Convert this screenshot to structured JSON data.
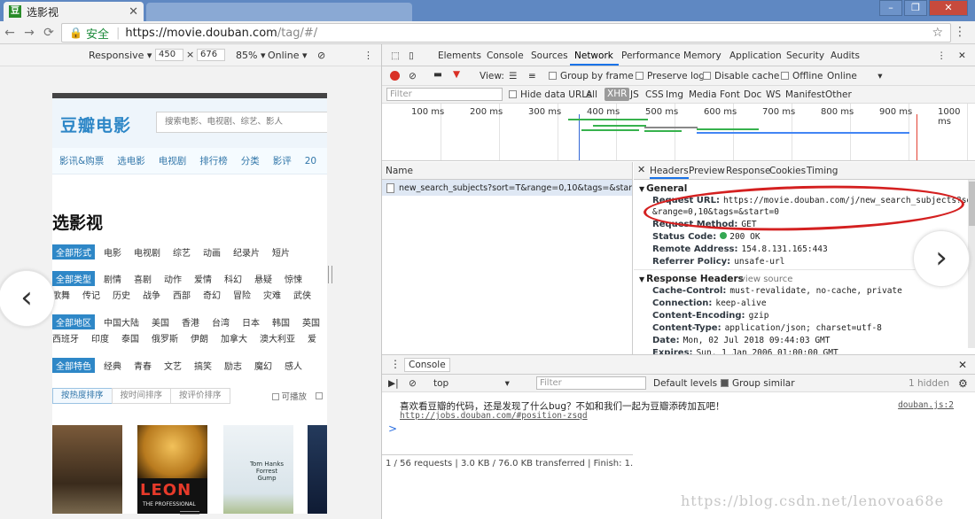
{
  "browser": {
    "active_tab_title": "选影视",
    "favicon_glyph": "豆",
    "tab_close": "✕",
    "secure_label": "安全",
    "url_host": "https://movie.douban.com",
    "url_path": "/tag/#/"
  },
  "device_toolbar": {
    "device": "Responsive",
    "width": "450",
    "times": "×",
    "height": "676",
    "zoom": "85%",
    "network": "Online"
  },
  "douban": {
    "logo": "豆瓣电影",
    "search_placeholder": "搜索电影、电视剧、综艺、影人",
    "nav": [
      "影讯&购票",
      "选电影",
      "电视剧",
      "排行榜",
      "分类",
      "影评",
      "20"
    ],
    "page_title": "选影视",
    "filters": [
      {
        "badge": "全部形式",
        "items": [
          "电影",
          "电视剧",
          "综艺",
          "动画",
          "纪录片",
          "短片"
        ]
      },
      {
        "badge": "全部类型",
        "items": [
          "剧情",
          "喜剧",
          "动作",
          "爱情",
          "科幻",
          "悬疑",
          "惊悚"
        ]
      },
      {
        "badge": "",
        "items": [
          "歌舞",
          "传记",
          "历史",
          "战争",
          "西部",
          "奇幻",
          "冒险",
          "灾难",
          "武侠"
        ]
      },
      {
        "badge": "全部地区",
        "items": [
          "中国大陆",
          "美国",
          "香港",
          "台湾",
          "日本",
          "韩国",
          "英国"
        ]
      },
      {
        "badge": "",
        "items": [
          "西班牙",
          "印度",
          "泰国",
          "俄罗斯",
          "伊朗",
          "加拿大",
          "澳大利亚",
          "爱"
        ]
      },
      {
        "badge": "全部特色",
        "items": [
          "经典",
          "青春",
          "文艺",
          "搞笑",
          "励志",
          "魔幻",
          "感人"
        ]
      }
    ],
    "sort_options": [
      "按热度排序",
      "按时间排序",
      "按评价排序"
    ],
    "playable_label": "可播放",
    "poster_texts": {
      "leon": "LEON",
      "leon_sub": "THE PROFESSIONAL",
      "forrest": "Tom Hanks Forrest Gump"
    }
  },
  "devtools": {
    "tabs": [
      "Elements",
      "Console",
      "Sources",
      "Network",
      "Performance",
      "Memory",
      "Application",
      "Security",
      "Audits"
    ],
    "active_tab": "Network",
    "toolbar": {
      "view_label": "View:",
      "group_by_frame": "Group by frame",
      "preserve_log": "Preserve log",
      "disable_cache": "Disable cache",
      "offline": "Offline",
      "online": "Online"
    },
    "filter": {
      "placeholder": "Filter",
      "hide_data_urls": "Hide data URLs",
      "types": [
        "All",
        "XHR",
        "JS",
        "CSS",
        "Img",
        "Media",
        "Font",
        "Doc",
        "WS",
        "Manifest",
        "Other"
      ],
      "active_type": "XHR"
    },
    "timeline_ticks": [
      "100 ms",
      "200 ms",
      "300 ms",
      "400 ms",
      "500 ms",
      "600 ms",
      "700 ms",
      "800 ms",
      "900 ms",
      "1000 ms"
    ],
    "name_header": "Name",
    "request_name": "new_search_subjects?sort=T&range=0,10&tags=&start=0",
    "status_bar": "1 / 56 requests | 3.0 KB / 76.0 KB transferred | Finish: 1.08 s",
    "header_tabs": [
      "Headers",
      "Preview",
      "Response",
      "Cookies",
      "Timing"
    ],
    "general": {
      "title": "General",
      "request_url_key": "Request URL:",
      "request_url_line1": "https://movie.douban.com/j/new_search_subjects?sort=T",
      "request_url_line2": "&range=0,10&tags=&start=0",
      "method_key": "Request Method:",
      "method": "GET",
      "status_key": "Status Code:",
      "status": "200 OK",
      "remote_key": "Remote Address:",
      "remote": "154.8.131.165:443",
      "referrer_key": "Referrer Policy:",
      "referrer": "unsafe-url"
    },
    "response_headers": {
      "title": "Response Headers",
      "view_source": "view source",
      "rows": [
        {
          "k": "Cache-Control:",
          "v": "must-revalidate, no-cache, private"
        },
        {
          "k": "Connection:",
          "v": "keep-alive"
        },
        {
          "k": "Content-Encoding:",
          "v": "gzip"
        },
        {
          "k": "Content-Type:",
          "v": "application/json; charset=utf-8"
        },
        {
          "k": "Date:",
          "v": "Mon, 02 Jul 2018 09:44:03 GMT"
        },
        {
          "k": "Expires:",
          "v": "Sun, 1 Jan 2006 01:00:00 GMT"
        }
      ]
    },
    "console": {
      "tab": "Console",
      "context": "top",
      "filter_placeholder": "Filter",
      "levels": "Default levels",
      "group_similar": "Group similar",
      "hidden": "1 hidden",
      "message": "喜欢看豆瓣的代码，还是发现了什么bug？不如和我们一起为豆瓣添砖加瓦吧！",
      "message_link": "http://jobs.douban.com/#position-zsqd",
      "source": "douban.js:2",
      "prompt": ">"
    }
  },
  "watermark": "https://blog.csdn.net/lenovoa68e"
}
